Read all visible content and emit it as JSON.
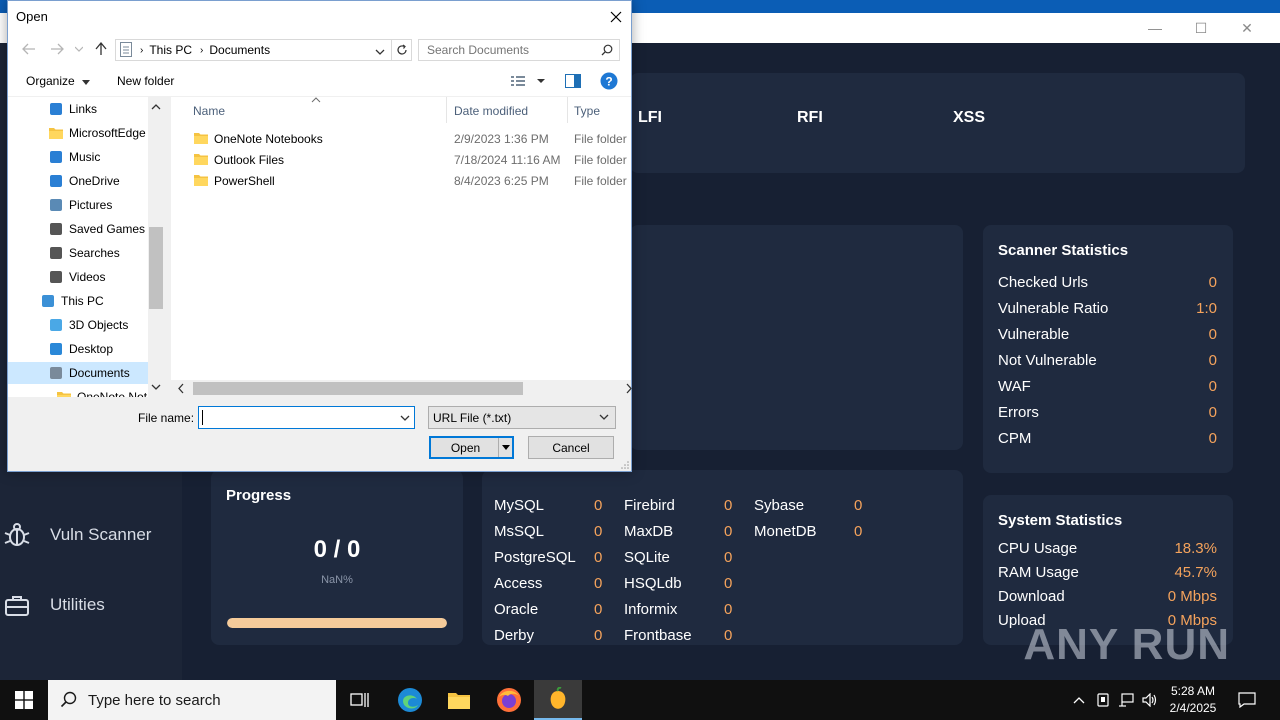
{
  "background_app": {
    "sidebar": [
      {
        "label": "Vuln Scanner",
        "icon": "bug-icon"
      },
      {
        "label": "Utilities",
        "icon": "toolbox-icon"
      }
    ],
    "vuln_tabs": [
      "LFI",
      "RFI",
      "XSS"
    ],
    "scanner_stats": {
      "title": "Scanner Statistics",
      "rows": [
        {
          "label": "Checked Urls",
          "value": "0"
        },
        {
          "label": "Vulnerable Ratio",
          "value": "1:0"
        },
        {
          "label": "Vulnerable",
          "value": "0"
        },
        {
          "label": "Not Vulnerable",
          "value": "0"
        },
        {
          "label": "WAF",
          "value": "0"
        },
        {
          "label": "Errors",
          "value": "0"
        },
        {
          "label": "CPM",
          "value": "0"
        }
      ]
    },
    "progress": {
      "title": "Progress",
      "count": "0 / 0",
      "percent": "NaN%",
      "fill_fraction": 1.0
    },
    "databases": [
      {
        "name": "MySQL",
        "value": "0"
      },
      {
        "name": "MsSQL",
        "value": "0"
      },
      {
        "name": "PostgreSQL",
        "value": "0"
      },
      {
        "name": "Access",
        "value": "0"
      },
      {
        "name": "Oracle",
        "value": "0"
      },
      {
        "name": "Derby",
        "value": "0"
      },
      {
        "name": "Firebird",
        "value": "0"
      },
      {
        "name": "MaxDB",
        "value": "0"
      },
      {
        "name": "SQLite",
        "value": "0"
      },
      {
        "name": "HSQLdb",
        "value": "0"
      },
      {
        "name": "Informix",
        "value": "0"
      },
      {
        "name": "Frontbase",
        "value": "0"
      },
      {
        "name": "Sybase",
        "value": "0"
      },
      {
        "name": "MonetDB",
        "value": "0"
      }
    ],
    "system_stats": {
      "title": "System Statistics",
      "rows": [
        {
          "label": "CPU Usage",
          "value": "18.3%"
        },
        {
          "label": "RAM Usage",
          "value": "45.7%"
        },
        {
          "label": "Download",
          "value": "0 Mbps"
        },
        {
          "label": "Upload",
          "value": "0 Mbps"
        }
      ]
    },
    "watermark": "ANY RUN"
  },
  "dialog": {
    "title": "Open",
    "breadcrumb": [
      "This PC",
      "Documents"
    ],
    "search_placeholder": "Search Documents",
    "toolbar": {
      "organize": "Organize",
      "new_folder": "New folder"
    },
    "tree": [
      {
        "label": "Links",
        "icon": "links-icon"
      },
      {
        "label": "MicrosoftEdge",
        "icon": "folder-icon"
      },
      {
        "label": "Music",
        "icon": "music-icon"
      },
      {
        "label": "OneDrive",
        "icon": "cloud-icon"
      },
      {
        "label": "Pictures",
        "icon": "pictures-icon"
      },
      {
        "label": "Saved Games",
        "icon": "saved-games-icon"
      },
      {
        "label": "Searches",
        "icon": "searches-icon"
      },
      {
        "label": "Videos",
        "icon": "videos-icon"
      },
      {
        "label": "This PC",
        "icon": "computer-icon"
      },
      {
        "label": "3D Objects",
        "icon": "cube-icon"
      },
      {
        "label": "Desktop",
        "icon": "desktop-icon"
      },
      {
        "label": "Documents",
        "icon": "documents-icon"
      },
      {
        "label": "OneNote Not",
        "icon": "folder-icon"
      }
    ],
    "columns": {
      "name": "Name",
      "date": "Date modified",
      "type": "Type"
    },
    "files": [
      {
        "name": "OneNote Notebooks",
        "date": "2/9/2023 1:36 PM",
        "type": "File folder"
      },
      {
        "name": "Outlook Files",
        "date": "7/18/2024 11:16 AM",
        "type": "File folder"
      },
      {
        "name": "PowerShell",
        "date": "8/4/2023 6:25 PM",
        "type": "File folder"
      }
    ],
    "filename_label": "File name:",
    "filename_value": "",
    "filetype": "URL File (*.txt)",
    "open_label": "Open",
    "cancel_label": "Cancel"
  },
  "taskbar": {
    "search_placeholder": "Type here to search",
    "time": "5:28 AM",
    "date": "2/4/2025"
  }
}
